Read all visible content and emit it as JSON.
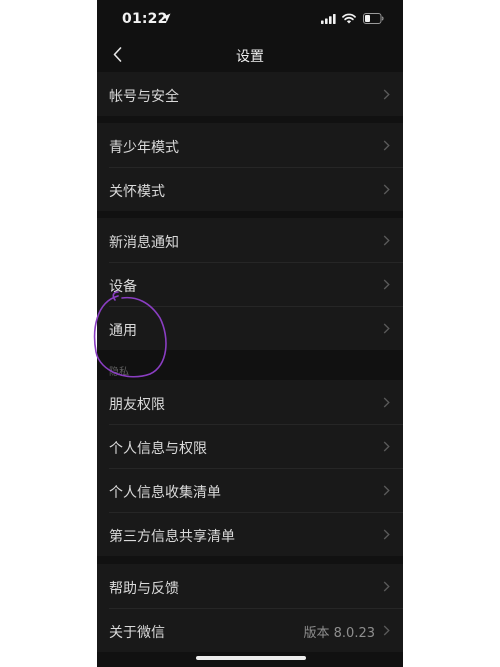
{
  "status_bar": {
    "time": "01:22"
  },
  "nav": {
    "title": "设置",
    "back_icon": "chevron-left-icon"
  },
  "groups": [
    {
      "items": [
        {
          "label": "帐号与安全"
        }
      ]
    },
    {
      "items": [
        {
          "label": "青少年模式"
        },
        {
          "label": "关怀模式"
        }
      ]
    },
    {
      "items": [
        {
          "label": "新消息通知"
        },
        {
          "label": "设备"
        },
        {
          "label": "通用"
        }
      ]
    },
    {
      "section_header": "隐私",
      "items": [
        {
          "label": "朋友权限"
        },
        {
          "label": "个人信息与权限"
        },
        {
          "label": "个人信息收集清单"
        },
        {
          "label": "第三方信息共享清单"
        }
      ]
    },
    {
      "items": [
        {
          "label": "帮助与反馈"
        },
        {
          "label": "关于微信",
          "value": "版本 8.0.23"
        }
      ]
    }
  ],
  "colors": {
    "page_background": "#ffffff",
    "screen_background": "#111111",
    "cell_background": "#191919",
    "text_primary": "#dadada",
    "text_secondary": "#8e8e8e",
    "annotation_stroke": "#8a3ec2"
  }
}
